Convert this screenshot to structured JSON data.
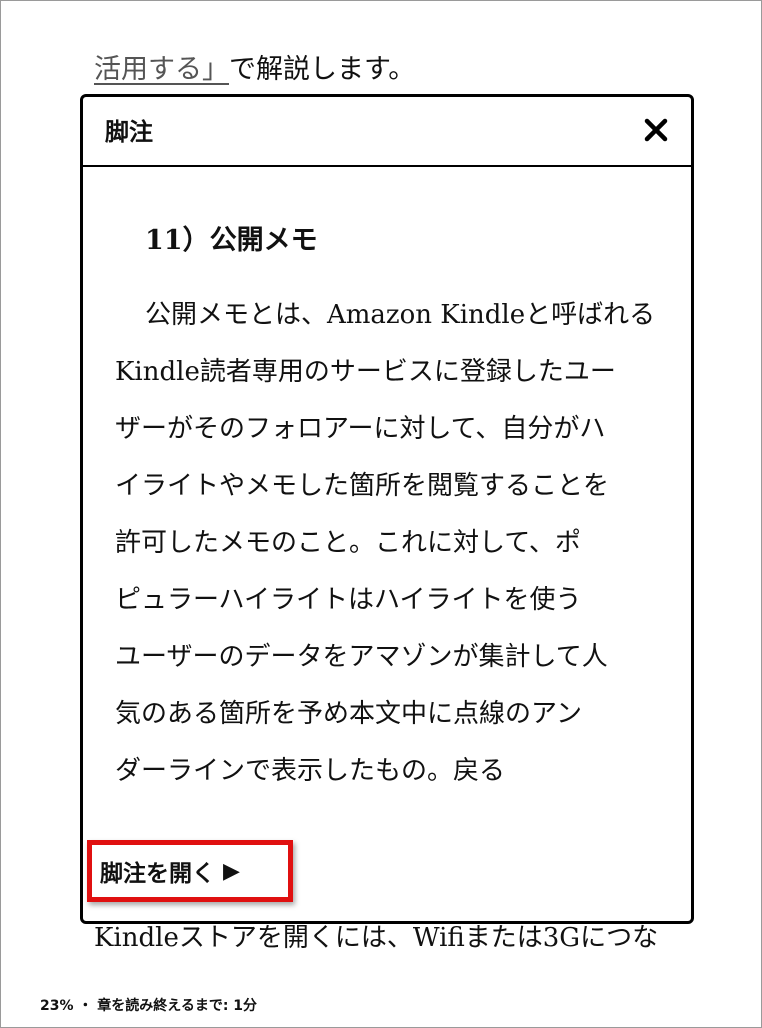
{
  "book": {
    "top_line_link": "活用する」",
    "top_line_rest": "で解説します。",
    "bottom_line": "Kindleストアを開くには、Wifiまたは3Gにつな"
  },
  "dialog": {
    "title": "脚注",
    "close_icon": "close-icon",
    "heading": "11）公開メモ",
    "lines": [
      "公開メモとは、Amazon Kindleと呼ばれる",
      "Kindle読者専用のサービスに登録したユー",
      "ザーがそのフォロアーに対して、自分がハ",
      "イライトやメモした箇所を閲覧することを",
      "許可したメモのこと。これに対して、ポ",
      "ピュラーハイライトはハイライトを使う",
      "ユーザーのデータをアマゾンが集計して人",
      "気のある箇所を予め本文中に点線のアン",
      "ダーラインで表示したもの。戻る"
    ],
    "open_footnote_label": "脚注を開く",
    "open_footnote_arrow": "▶",
    "highlight_color": "#e01010"
  },
  "status": {
    "text": "23% ・ 章を読み終えるまで: 1分"
  }
}
